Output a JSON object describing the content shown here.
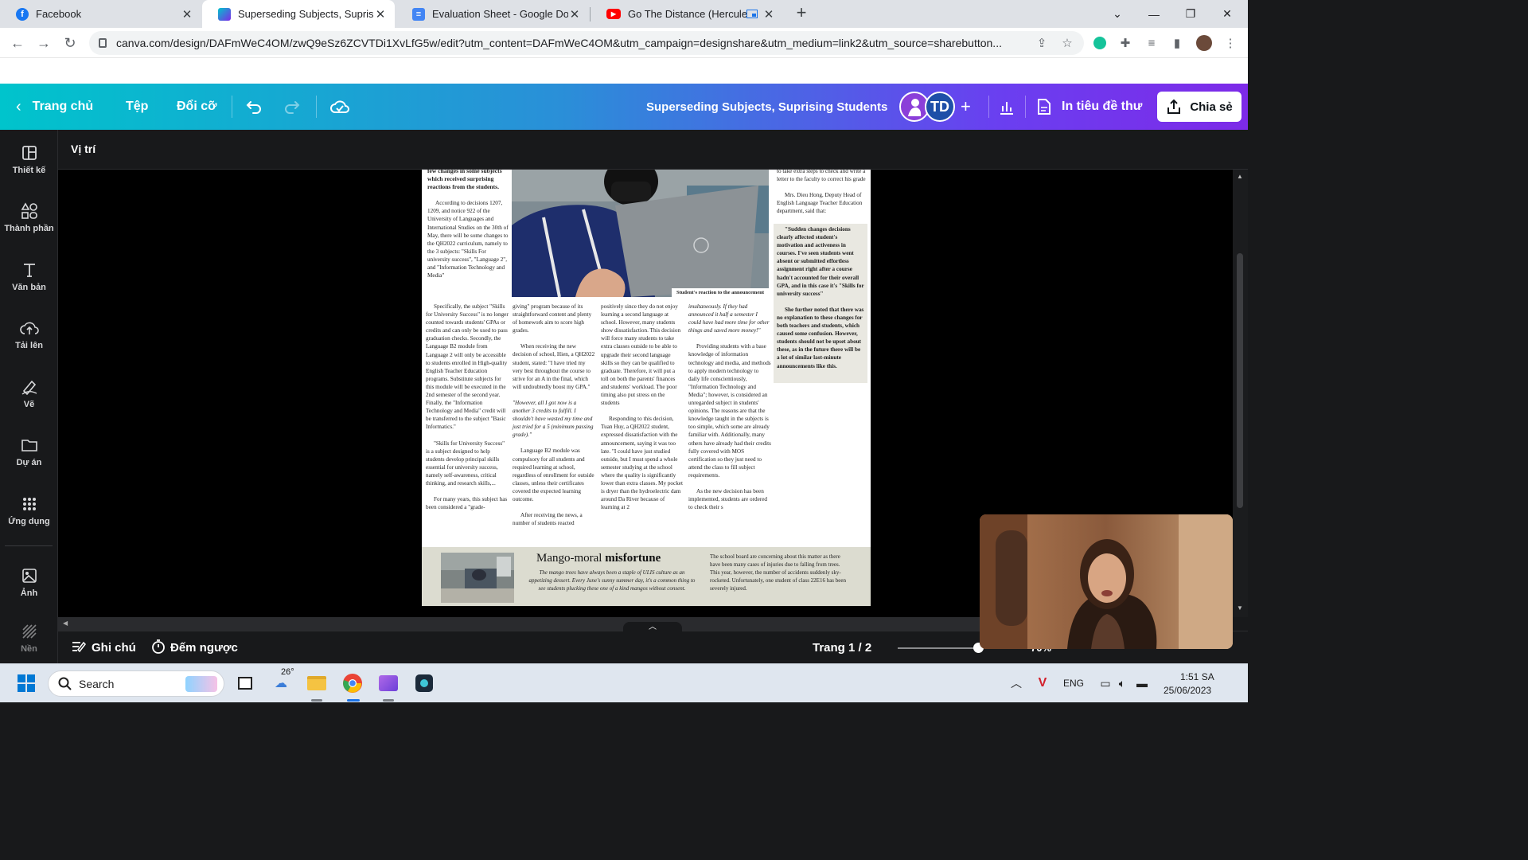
{
  "browser": {
    "tabs": [
      {
        "title": "Facebook",
        "close": "✕"
      },
      {
        "title": "Superseding Subjects, Suprising S",
        "close": "✕"
      },
      {
        "title": "Evaluation Sheet - Google Docs",
        "close": "✕"
      },
      {
        "title": "Go The Distance (Hercules) (",
        "close": "✕"
      }
    ],
    "new_tab": "+",
    "url": "canva.com/design/DAFmWeC4OM/zwQ9eSz6ZCVTDi1XvLfG5w/edit?utm_content=DAFmWeC4OM&utm_campaign=designshare&utm_medium=link2&utm_source=sharebutton..."
  },
  "canva_header": {
    "home": "Trang chủ",
    "file": "Tệp",
    "resize": "Đổi cỡ",
    "design_title": "Superseding Subjects,  Suprising Students",
    "avatar_initials": "TD",
    "add": "+",
    "print": "In tiêu đề thư",
    "share": "Chia sẻ"
  },
  "sidebar": {
    "items": [
      {
        "label": "Thiết kế",
        "icon": "layout-icon"
      },
      {
        "label": "Thành phần",
        "icon": "elements-icon"
      },
      {
        "label": "Văn bản",
        "icon": "text-icon"
      },
      {
        "label": "Tải lên",
        "icon": "upload-icon"
      },
      {
        "label": "Vẽ",
        "icon": "draw-icon"
      },
      {
        "label": "Dự án",
        "icon": "folder-icon"
      },
      {
        "label": "Ứng dụng",
        "icon": "apps-icon"
      },
      {
        "label": "Ảnh",
        "icon": "photo-icon"
      },
      {
        "label": "Nền",
        "icon": "background-icon"
      }
    ]
  },
  "context_bar": {
    "position": "Vị trí"
  },
  "newspaper": {
    "col1": [
      "few changes in some subjects which received surprising reactions from the students.",
      "According to decisions 1207, 1209, and notice 922 of the University of Languages and International Studies on the 30th of May, there will be some changes to the QH2022 curriculum, namely to the 3 subjects: \"Skills For university success\", \"Language 2\", and \"Information Technology and Media\"",
      "Specifically, the subject \"Skills for University Success\" is no longer counted towards students' GPAs or credits and can only be used to pass graduation checks. Secondly, the Language B2 module from Language 2 will only be accessible to students enrolled in High-quality English Teacher Education programs. Substitute subjects for this module will be executed in the 2nd semester of the second year. Finally, the \"Information Technology and Media\" credit will be transferred to the subject \"Basic Informatics.\"",
      "\"Skills for University Success\" is a subject designed to help students develop principal skills essential for university success, namely self-awareness, critical thinking, and research skills,...",
      "For many years, this subject has been considered a \"grade-"
    ],
    "photo_caption": "Student's reaction to the announcement",
    "col2": [
      "giving\" program because of its straightforward content and plenty of homework aim to score high grades.",
      "When receiving the new decision of school, Hien, a QH2022 student, stated: \"I have tried my very best throughout the course to strive for an A in the final, which will undoubtedly boost my GPA.\"",
      "\"However, all I got now is a another 3 credits to fulfill. I shouldn't have wasted my time and just tried for a 5 (minimum passing grade).\"",
      "Language B2 module was compulsory for all students and required learning at school, regardless of enrollment for outside classes, unless their certificates covered the expected learning outcome.",
      "After receiving the news, a number of students reacted"
    ],
    "col3": [
      "positively since they do not enjoy learning a second language at school. However, many students show dissatisfaction. This decision will force many students to take extra classes outside to be able to upgrade their second language skills so they can be qualified to graduate. Therefore, it will put a toll on both the parents' finances and students' workload. The poor timing also put stress on the students",
      "Responding to this decision, Tuan Huy, a QH2022 student, expressed dissatisfaction with the announcement, saying it was too late. \"I could have just studied outside, but I must spend a whole semester studying at the school where the quality is significantly lower than extra classes. My pocket is dryer than the hydroelectric dam around Da River because of learning at 2"
    ],
    "col4": [
      "imultaneously. If they had announced it half a semester I could have had more time for other things and saved  more money!\"",
      "Providing students with a base knowledge of information technology and media, and methods to apply modern technology to daily life conscientiously, \"Information Technology and Media\"; however, is considered an unregarded subject in students' opinions. The reasons are that the knowledge taught in the subjects is too simple, which some are already familiar with. Additionally, many others have already had their credits fully covered with MOS certification so they just need to attend the class to fill subject requirements.",
      "As the new decision has been implemented, students are ordered to check their s"
    ],
    "col5_top": [
      "to take extra steps to check and write a letter to the faculty to correct his grade",
      "Mrs. Dieu Hong, Deputy Head of English Language Teacher Education department, said that:"
    ],
    "quote": [
      "\"Sudden changes decisions clearly affected student's motivation and activeness in courses. I've seen students went absent or submitted effortless assignment right after a course hadn't accounted for their overall GPA, and in this case it's \"Skills for university success\"",
      "She further noted that there was no explanation to these changes for both teachers and students, which caused some confusion. However, students should not be upset about these, as in the future there will be a lot of similar last-minute announcements like this."
    ],
    "footer": {
      "title_plain": "Mango-moral ",
      "title_bold": "misfortune",
      "intro": "The mango trees have always been a staple of ULIS culture as an appetizing dessert. Every June's sunny summer day, it's a common thing to see students plucking these one of a kind mangos without consent.",
      "body": "The school board are concerning about this matter as there have been many cases of injuries due to falling from trees. This year, however, the number of accidents suddenly sky-rocketed. Unfortunately, one student of class 22E16 has been severely injured."
    }
  },
  "bottom_bar": {
    "notes": "Ghi chú",
    "timer": "Đếm ngược",
    "page": "Trang 1 / 2",
    "zoom": "70%"
  },
  "taskbar": {
    "search": "Search",
    "weather": "26°",
    "lang": "ENG",
    "time": "1:51 SA",
    "date": "25/06/2023"
  },
  "colors": {
    "canva_gradient_start": "#00c4cc",
    "canva_gradient_end": "#7d2ae8",
    "editor_bg": "#18191b"
  }
}
